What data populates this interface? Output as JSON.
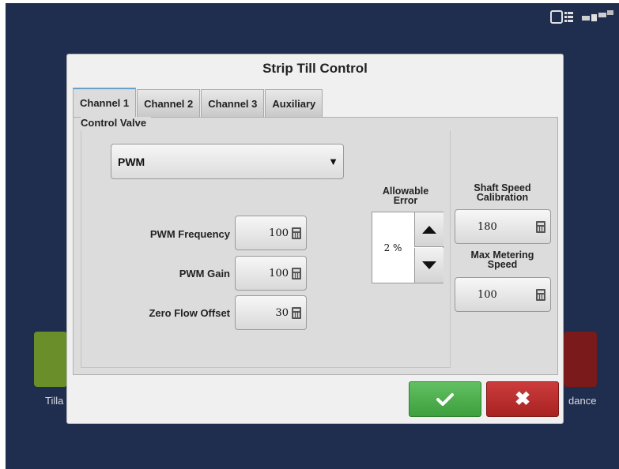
{
  "dialog": {
    "title": "Strip Till Control"
  },
  "tabs": [
    {
      "label": "Channel 1",
      "active": true
    },
    {
      "label": "Channel 2",
      "active": false
    },
    {
      "label": "Channel 3",
      "active": false
    },
    {
      "label": "Auxiliary",
      "active": false
    }
  ],
  "control_valve": {
    "label": "Control Valve",
    "selected": "PWM"
  },
  "fields": {
    "pwm_frequency": {
      "label": "PWM Frequency",
      "value": "100"
    },
    "pwm_gain": {
      "label": "PWM Gain",
      "value": "100"
    },
    "zero_flow_offset": {
      "label": "Zero Flow Offset",
      "value": "30"
    }
  },
  "allowable_error": {
    "label_line1": "Allowable",
    "label_line2": "Error",
    "value": "2 %"
  },
  "shaft_speed": {
    "label_line1": "Shaft Speed",
    "label_line2": "Calibration",
    "value": "180"
  },
  "max_metering": {
    "label_line1": "Max Metering",
    "label_line2": "Speed",
    "value": "100"
  },
  "actions": {
    "ok_icon": "check-icon",
    "cancel_icon": "x-icon",
    "cancel_glyph": "✖"
  },
  "background": {
    "left_label": "Tilla",
    "right_label": "dance"
  },
  "colors": {
    "ok": "#4caf4c",
    "cancel": "#b82c2c",
    "screen_bg": "#1f2d4e"
  }
}
